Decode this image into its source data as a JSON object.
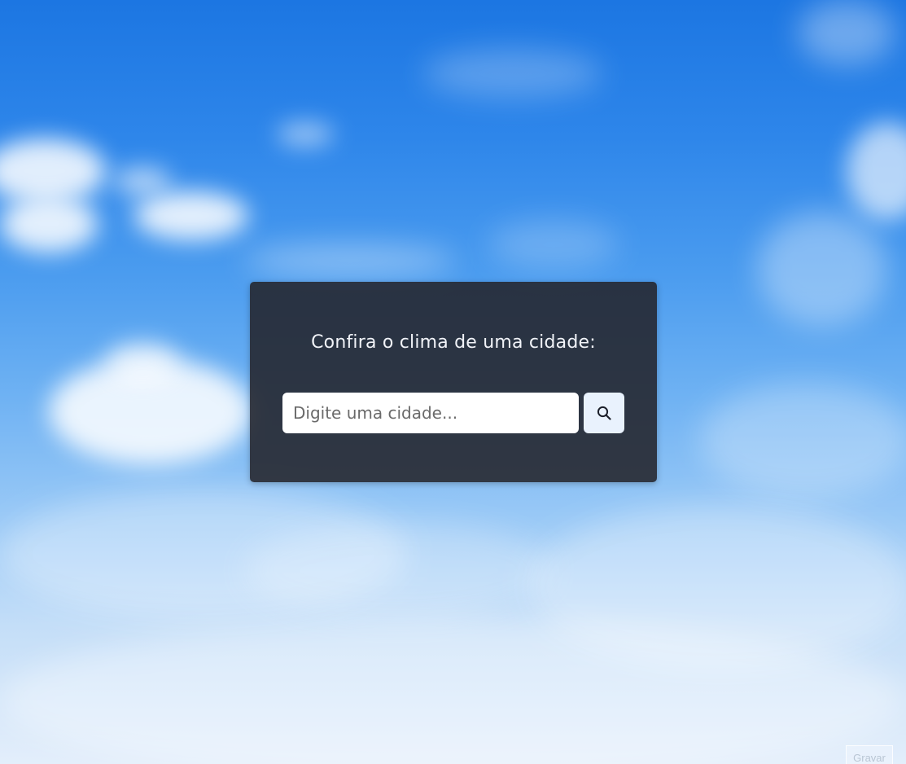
{
  "background": {
    "description_icon": "sky-clouds-background",
    "color_top": "#1c76e2",
    "color_bottom": "#e3eefb"
  },
  "card": {
    "title": "Confira o clima de uma cidade:",
    "background_color": "#23232a"
  },
  "search": {
    "placeholder": "Digite uma cidade...",
    "value": "",
    "button_icon": "search-icon"
  },
  "corner_button": {
    "label": "Gravar"
  }
}
